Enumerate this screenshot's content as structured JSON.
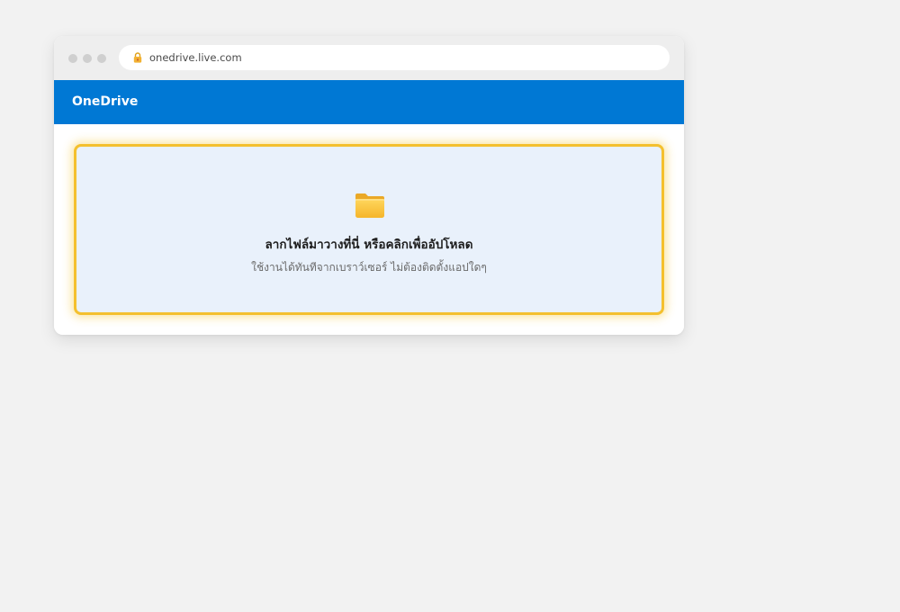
{
  "browser": {
    "url": "onedrive.live.com",
    "lock_icon": "lock-icon",
    "window_controls": [
      "close",
      "minimize",
      "maximize"
    ]
  },
  "app": {
    "title": "OneDrive",
    "brand_color": "#0078d4"
  },
  "upload": {
    "icon": "folder-icon",
    "title": "ลากไฟล์มาวางที่นี่ หรือคลิกเพื่ออัปโหลด",
    "subtitle": "ใช้งานได้ทันทีจากเบราว์เซอร์ ไม่ต้องติดตั้งแอปใดๆ",
    "highlight_color": "#f4c02e",
    "zone_color": "#e9f1fb"
  }
}
